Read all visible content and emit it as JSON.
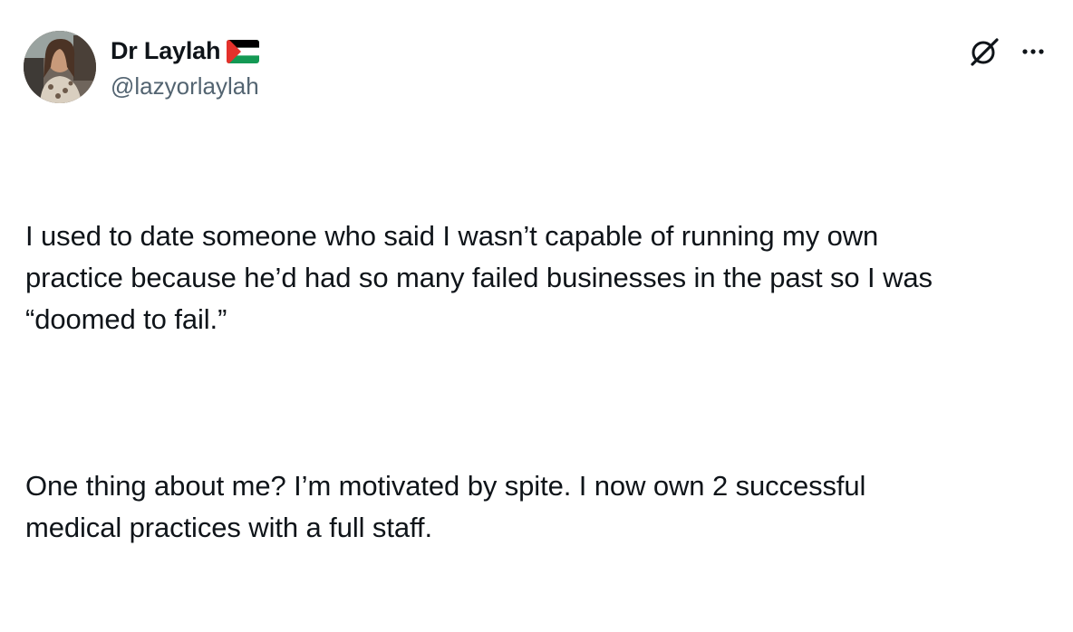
{
  "author": {
    "display_name": "Dr Laylah",
    "flag_icon": "palestine-flag-icon",
    "handle": "@lazyorlaylah",
    "avatar": "profile-photo"
  },
  "actions": {
    "grok_icon": "grok-icon",
    "more_icon": "more-options-icon"
  },
  "tweet": {
    "paragraphs": [
      "I used to date someone who said I wasn’t capable of running my own\npractice because he’d had so many failed businesses in the past so I was\n“doomed to fail.”",
      "One thing about me? I’m motivated by spite. I now own 2 successful\nmedical practices with a full staff."
    ]
  },
  "colors": {
    "text": "#0f1419",
    "secondary": "#536471",
    "flag_red": "#e4312b",
    "flag_green": "#149954",
    "flag_black": "#000000"
  }
}
